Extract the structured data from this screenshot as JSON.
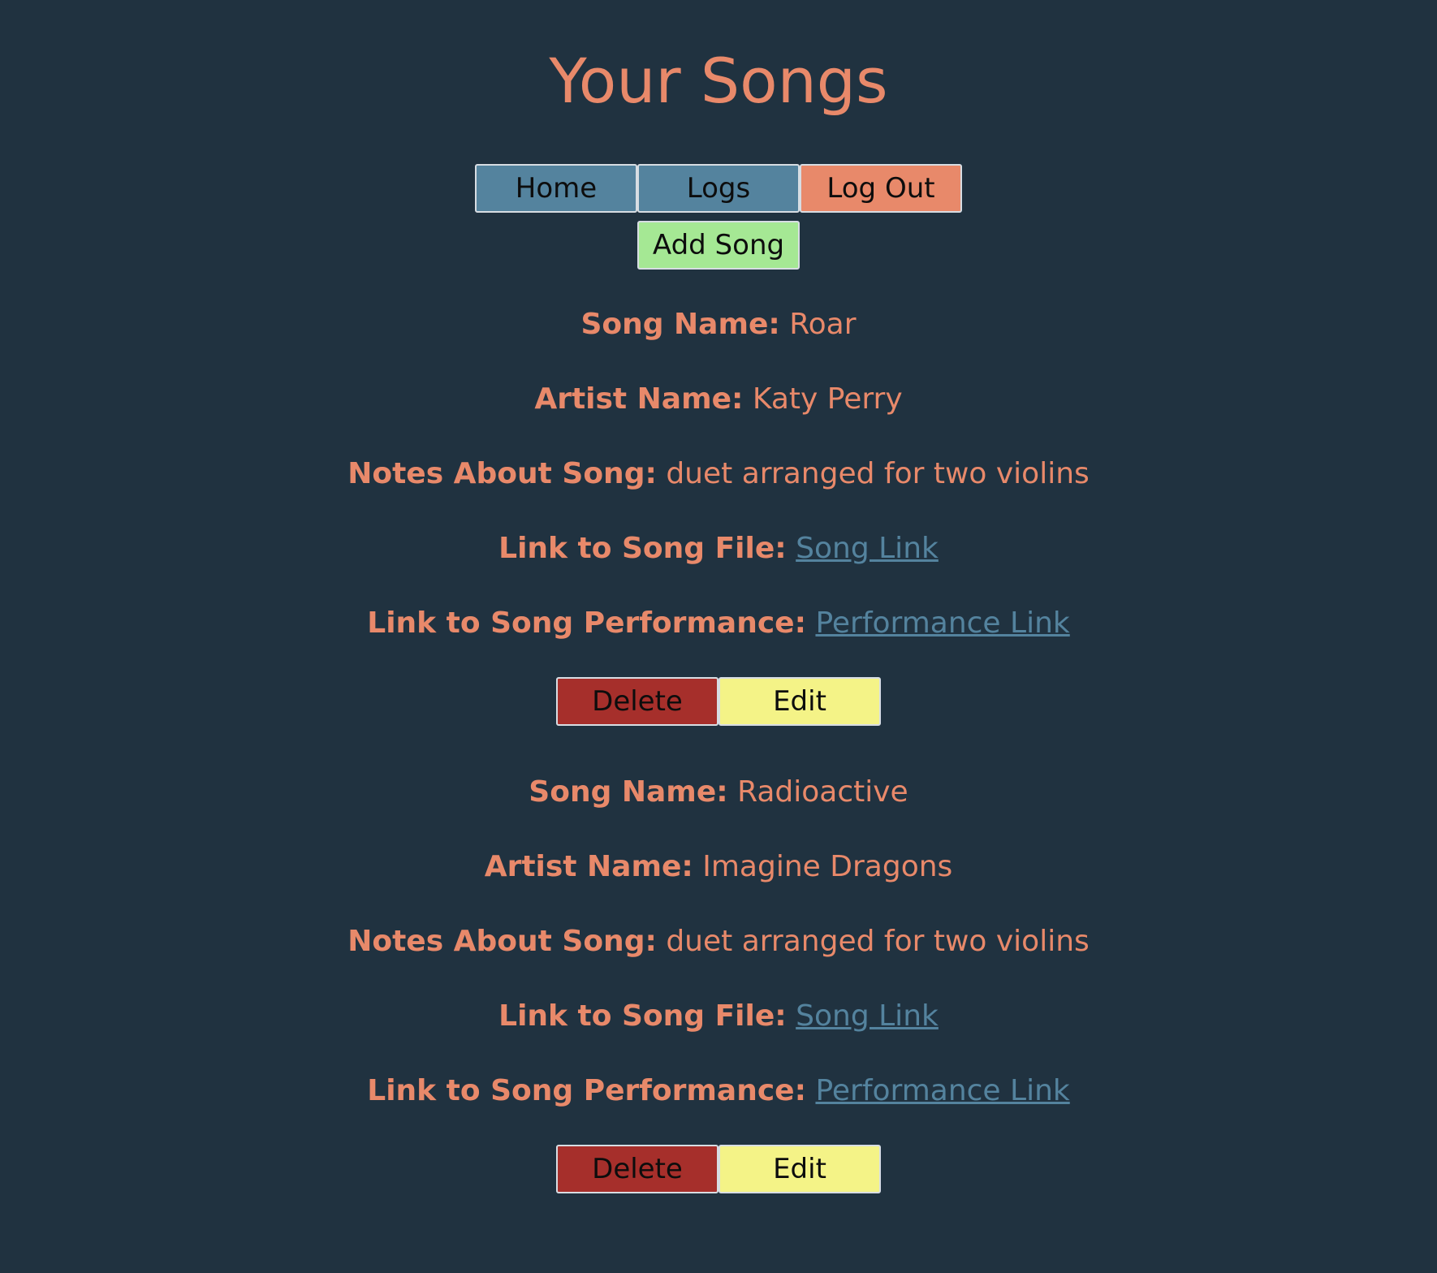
{
  "header": {
    "title": "Your Songs"
  },
  "nav": {
    "home_label": "Home",
    "logs_label": "Logs",
    "logout_label": "Log Out",
    "add_song_label": "Add Song"
  },
  "colors": {
    "background": "#203240",
    "text": "#e8896a",
    "link": "#54839e",
    "home_button": "#54839e",
    "logout_button": "#e8896a",
    "add_button": "#a5e894",
    "delete_button": "#a62f2b",
    "edit_button": "#f4f387"
  },
  "songs": [
    {
      "song_name_label": "Song Name:",
      "song_name": "Roar",
      "artist_label": "Artist Name:",
      "artist": "Katy Perry",
      "notes_label": "Notes About Song:",
      "notes": "duet arranged for two violins",
      "file_label": "Link to Song File:",
      "file_link_text": "Song Link",
      "performance_label": "Link to Song Performance:",
      "performance_link_text": "Performance Link",
      "delete_label": "Delete",
      "edit_label": "Edit"
    },
    {
      "song_name_label": "Song Name:",
      "song_name": "Radioactive",
      "artist_label": "Artist Name:",
      "artist": "Imagine Dragons",
      "notes_label": "Notes About Song:",
      "notes": "duet arranged for two violins",
      "file_label": "Link to Song File:",
      "file_link_text": "Song Link",
      "performance_label": "Link to Song Performance:",
      "performance_link_text": "Performance Link",
      "delete_label": "Delete",
      "edit_label": "Edit"
    }
  ]
}
